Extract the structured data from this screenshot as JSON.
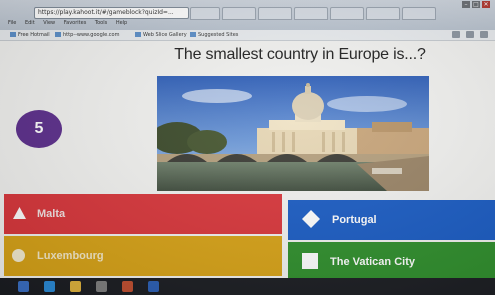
{
  "browser": {
    "url": "https://play.kahoot.it/#/gameblock?quizId=...",
    "menu": [
      "File",
      "Edit",
      "View",
      "Favorites",
      "Tools",
      "Help"
    ],
    "favorites": [
      "Free Hotmail",
      "http--www.google.com",
      "Web Slice Gallery",
      "Suggested Sites"
    ],
    "window_buttons": [
      "–",
      "□",
      "✕"
    ]
  },
  "quiz": {
    "question": "The smallest country in Europe is...?",
    "timer": "5",
    "image_icon": "vatican-st-peters-basilica-photo"
  },
  "answers": [
    {
      "label": "Malta",
      "shape": "triangle-icon",
      "color": "#d9363b"
    },
    {
      "label": "Portugal",
      "shape": "diamond-icon",
      "color": "#1a5cc4"
    },
    {
      "label": "Luxembourg",
      "shape": "circle-icon",
      "color": "#d8a317"
    },
    {
      "label": "The Vatican City",
      "shape": "square-icon",
      "color": "#2f8f2c"
    }
  ],
  "colors": {
    "timer_bg": "#5c2e8c",
    "red": "#d9363b",
    "blue": "#1a5cc4",
    "yellow": "#d8a317",
    "green": "#2f8f2c"
  }
}
